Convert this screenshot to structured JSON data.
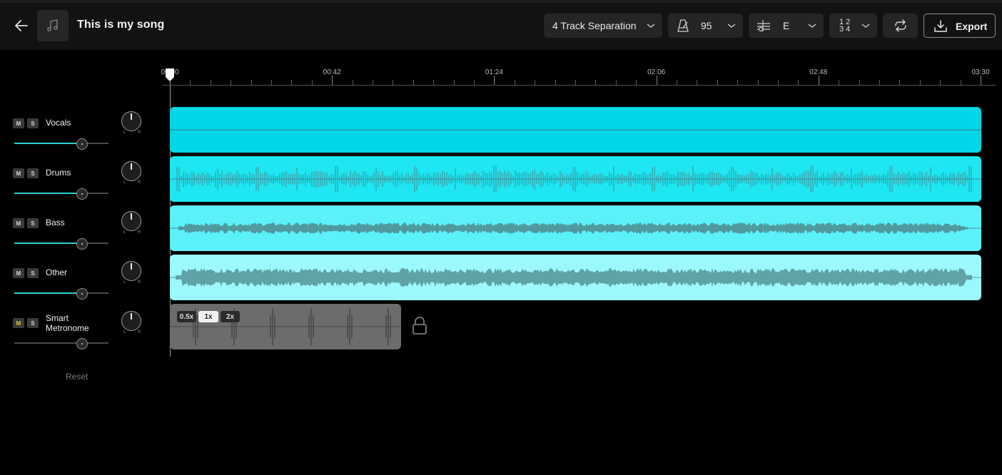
{
  "header": {
    "title": "This is my song",
    "separation_label": "4 Track Separation",
    "tempo_value": "95",
    "key_value": "E",
    "time_signature_top": "1 2",
    "time_signature_bottom": "3 4",
    "export_label": "Export"
  },
  "timeline": {
    "labels": [
      "00:00",
      "00:42",
      "01:24",
      "02:06",
      "02:48",
      "03:30"
    ]
  },
  "tracks": [
    {
      "name": "Vocals",
      "volume": 0.72,
      "color": "#00d7e6"
    },
    {
      "name": "Drums",
      "volume": 0.72,
      "color": "#1ee6f2"
    },
    {
      "name": "Bass",
      "volume": 0.72,
      "color": "#5bf1f9"
    },
    {
      "name": "Other",
      "volume": 0.72,
      "color": "#9bf8fc"
    }
  ],
  "metronome": {
    "name_line1": "Smart",
    "name_line2": "Metronome",
    "volume": 0.72,
    "speeds": [
      "0.5x",
      "1x",
      "2x"
    ],
    "selected_speed": "1x"
  },
  "labels": {
    "mute": "M",
    "solo": "S",
    "pan_left": "L",
    "pan_right": "R",
    "reset": "Reset"
  }
}
